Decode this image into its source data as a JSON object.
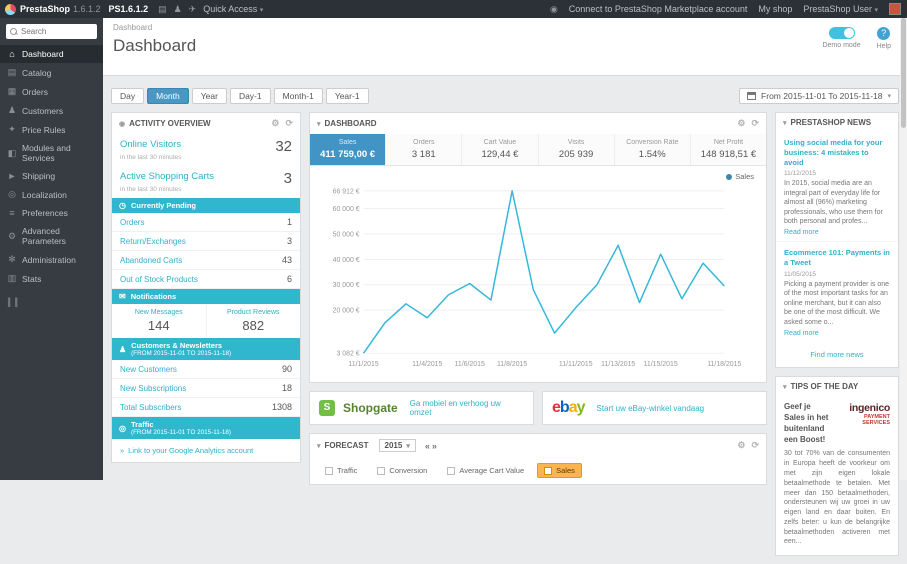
{
  "topbar": {
    "brand": "PrestaShop",
    "version": "1.6.1.2",
    "shop_code": "PS1.6.1.2",
    "quick_access": "Quick Access",
    "marketplace": "Connect to PrestaShop Marketplace account",
    "my_shop": "My shop",
    "user": "PrestaShop User"
  },
  "sidebar": {
    "search_placeholder": "Search",
    "items": [
      "Dashboard",
      "Catalog",
      "Orders",
      "Customers",
      "Price Rules",
      "Modules and Services",
      "Shipping",
      "Localization",
      "Preferences",
      "Advanced Parameters",
      "Administration",
      "Stats"
    ]
  },
  "header": {
    "breadcrumb": "Dashboard",
    "title": "Dashboard",
    "demo_mode": "Demo mode",
    "help": "Help"
  },
  "filters": {
    "buttons": [
      "Day",
      "Month",
      "Year",
      "Day-1",
      "Month-1",
      "Year-1"
    ],
    "active": "Month",
    "date_range": "From 2015-11-01 To 2015-11-18"
  },
  "activity": {
    "title": "ACTIVITY OVERVIEW",
    "online_visitors_label": "Online Visitors",
    "online_visitors_sub": "in the last 30 minutes",
    "online_visitors_value": "32",
    "active_carts_label": "Active Shopping Carts",
    "active_carts_sub": "in the last 30 minutes",
    "active_carts_value": "3",
    "pending_title": "Currently Pending",
    "pending_rows": [
      {
        "label": "Orders",
        "value": "1"
      },
      {
        "label": "Return/Exchanges",
        "value": "3"
      },
      {
        "label": "Abandoned Carts",
        "value": "43"
      },
      {
        "label": "Out of Stock Products",
        "value": "6"
      }
    ],
    "notifications_title": "Notifications",
    "notifications": [
      {
        "label": "New Messages",
        "value": "144"
      },
      {
        "label": "Product Reviews",
        "value": "882"
      }
    ],
    "customers_title": "Customers & Newsletters",
    "customers_range": "(FROM 2015-11-01 TO 2015-11-18)",
    "customers_rows": [
      {
        "label": "New Customers",
        "value": "90"
      },
      {
        "label": "New Subscriptions",
        "value": "18"
      },
      {
        "label": "Total Subscribers",
        "value": "1308"
      }
    ],
    "traffic_title": "Traffic",
    "traffic_range": "(FROM 2015-11-01 TO 2015-11-18)",
    "analytics_link": "Link to your Google Analytics account"
  },
  "dashboard_panel": {
    "title": "DASHBOARD",
    "kpis": [
      {
        "label": "Sales",
        "value": "411 759,00 €"
      },
      {
        "label": "Orders",
        "value": "3 181"
      },
      {
        "label": "Cart Value",
        "value": "129,44 €"
      },
      {
        "label": "Visits",
        "value": "205 939"
      },
      {
        "label": "Conversion Rate",
        "value": "1.54%"
      },
      {
        "label": "Net Profit",
        "value": "148 918,51 €"
      }
    ],
    "legend": "Sales"
  },
  "chart_data": {
    "type": "line",
    "title": "Sales",
    "series": [
      {
        "name": "Sales"
      }
    ],
    "x": [
      "11/1/2015",
      "11/2/2015",
      "11/3/2015",
      "11/4/2015",
      "11/5/2015",
      "11/6/2015",
      "11/7/2015",
      "11/8/2015",
      "11/9/2015",
      "11/10/2015",
      "11/11/2015",
      "11/12/2015",
      "11/13/2015",
      "11/14/2015",
      "11/15/2015",
      "11/16/2015",
      "11/17/2015",
      "11/18/2015"
    ],
    "values": [
      3082,
      15000,
      22500,
      17000,
      26000,
      30500,
      24000,
      66912,
      28000,
      11000,
      21000,
      30000,
      45500,
      23000,
      42000,
      24500,
      38500,
      29500
    ],
    "ylim": [
      3082,
      66912
    ],
    "ytick_values": [
      66912,
      60000,
      50000,
      40000,
      30000,
      20000,
      3082
    ],
    "ytick_labels": [
      "66 912 €",
      "60 000 €",
      "50 000 €",
      "40 000 €",
      "30 000 €",
      "20 000 €",
      "3 082 €"
    ],
    "xtick_labels": [
      "11/1/2015",
      "11/4/2015",
      "11/6/2015",
      "11/8/2015",
      "11/11/2015",
      "11/13/2015",
      "11/15/2015",
      "11/18/2015"
    ],
    "line_color": "#34b7db",
    "grid": true,
    "legend_position": "top-right"
  },
  "ads": {
    "shopgate_brand": "Shopgate",
    "shopgate_link": "Ga mobiel en verhoog uw omzet",
    "ebay_e": "e",
    "ebay_b": "b",
    "ebay_a": "a",
    "ebay_y": "y",
    "ebay_link": "Start uw eBay-winkel vandaag"
  },
  "forecast": {
    "title": "FORECAST",
    "year": "2015",
    "legend": [
      {
        "label": "Traffic"
      },
      {
        "label": "Conversion"
      },
      {
        "label": "Average Cart Value"
      },
      {
        "label": "Sales"
      }
    ]
  },
  "news": {
    "title": "PRESTASHOP NEWS",
    "articles": [
      {
        "headline": "Using social media for your business: 4 mistakes to avoid",
        "date": "11/12/2015",
        "body": "In 2015, social media are an integral part of everyday life for almost all (96%) marketing professionals, who use them for both personal and profes...",
        "read_more": "Read more"
      },
      {
        "headline": "Ecommerce 101: Payments in a Tweet",
        "date": "11/05/2015",
        "body": "Picking a payment provider is one of the most important tasks for an online merchant, but it can also be one of the most difficult. We asked some o...",
        "read_more": "Read more"
      }
    ],
    "more_link": "Find more news"
  },
  "tips": {
    "title": "TIPS OF THE DAY",
    "headline": "Geef je Sales in het buitenland een Boost!",
    "brand": "ingenico",
    "brand_sub": "PAYMENT SERVICES",
    "body": "30 tot 70% van de consumenten in Europa heeft de voorkeur om met zijn eigen lokale betaalmethode te betalen. Met meer dan 150 betaalmethoden, ondersteunen wij uw groei in uw eigen land en daar buiten. En zelfs beter: u kun de belangrijke betaalmethoden activeren met een..."
  },
  "colors": {
    "accent_cyan": "#2fb0c9",
    "bar_cyan": "#31b7cd",
    "active_blue": "#4a97c2",
    "forecast_orange": "#fbb450"
  }
}
